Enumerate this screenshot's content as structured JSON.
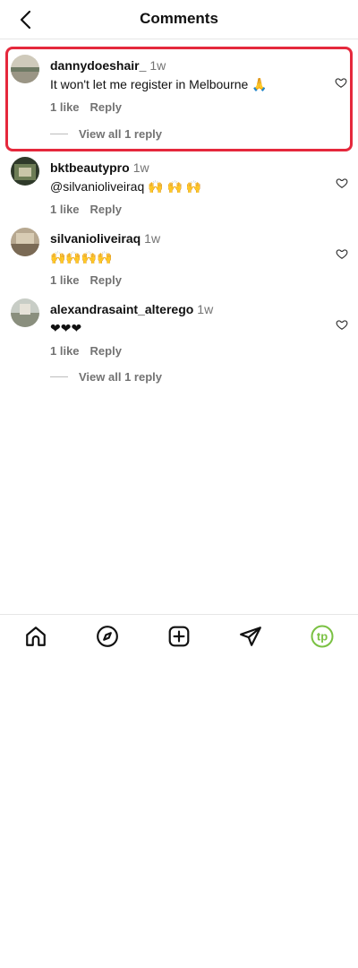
{
  "header": {
    "title": "Comments"
  },
  "comments": [
    {
      "username": "dannydoeshair_",
      "time": "1w",
      "text": "It won't let me register in Melbourne 🙏",
      "likes": "1 like",
      "reply_label": "Reply",
      "view_replies": "View all 1 reply"
    },
    {
      "username": "bktbeautypro",
      "time": "1w",
      "text": "@silvanioliveiraq 🙌 🙌 🙌",
      "likes": "1 like",
      "reply_label": "Reply"
    },
    {
      "username": "silvanioliveiraq",
      "time": "1w",
      "text": "🙌🙌🙌🙌",
      "likes": "1 like",
      "reply_label": "Reply"
    },
    {
      "username": "alexandrasaint_alterego",
      "time": "1w",
      "text": "❤❤❤",
      "likes": "1 like",
      "reply_label": "Reply",
      "view_replies": "View all 1 reply"
    }
  ],
  "nav": {
    "items": [
      "home-icon",
      "explore-icon",
      "create-icon",
      "messages-icon",
      "profile-icon"
    ],
    "profile_initials": "tp",
    "profile_color": "#7ac143"
  },
  "colors": {
    "highlight": "#e5283c",
    "muted": "#737373"
  }
}
